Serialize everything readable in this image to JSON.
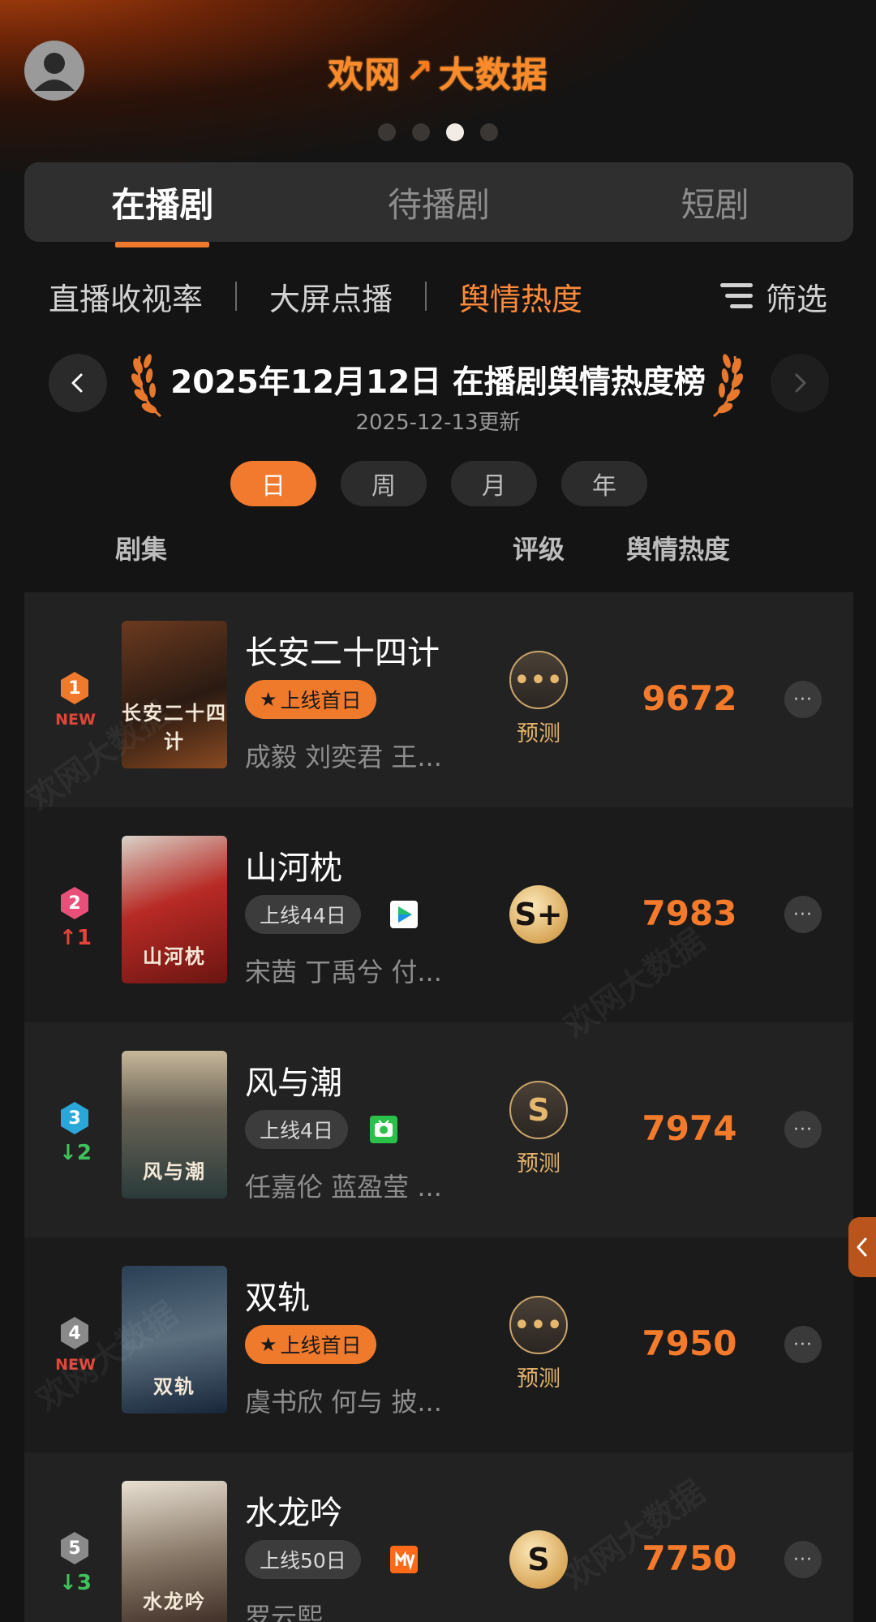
{
  "header": {
    "logo_text": "欢网",
    "logo_mark": "↗",
    "logo_text2": "大数据",
    "carousel_dots": 4,
    "carousel_active": 3
  },
  "main_tabs": [
    "在播剧",
    "待播剧",
    "短剧"
  ],
  "sub_tabs": [
    "直播收视率",
    "大屏点播",
    "舆情热度"
  ],
  "filter_label": "筛选",
  "chart_title": "2025年12月12日 在播剧舆情热度榜",
  "update_time": "2025-12-13更新",
  "periods": [
    "日",
    "周",
    "月",
    "年"
  ],
  "columns": {
    "show": "剧集",
    "rating": "评级",
    "heat": "舆情热度"
  },
  "rows": [
    {
      "rank": "1",
      "rank_color": "#f07a2c",
      "change": "NEW",
      "change_type": "new",
      "title": "长安二十四计",
      "poster_text": "长安二十四计",
      "tag": "上线首日",
      "tag_type": "hot",
      "platform": "",
      "cast": "成毅 刘奕君 王...",
      "rating": "•••",
      "rating_type": "pending",
      "rating_label": "预测",
      "heat": "9672"
    },
    {
      "rank": "2",
      "rank_color": "#e8507a",
      "change": "↑1",
      "change_type": "up",
      "title": "山河枕",
      "poster_text": "山河枕",
      "tag": "上线44日",
      "tag_type": "days",
      "platform": "iqiyi-icon",
      "cast": "宋茜 丁禹兮 付...",
      "rating": "S+",
      "rating_type": "splus",
      "rating_label": "",
      "heat": "7983"
    },
    {
      "rank": "3",
      "rank_color": "#2aa7d9",
      "change": "↓2",
      "change_type": "down",
      "title": "风与潮",
      "poster_text": "风与潮",
      "tag": "上线4日",
      "tag_type": "days",
      "platform": "youku-icon",
      "cast": "任嘉伦 蓝盈莹 ...",
      "rating": "S",
      "rating_type": "s-dark",
      "rating_label": "预测",
      "heat": "7974"
    },
    {
      "rank": "4",
      "rank_color": "#8a8a8a",
      "change": "NEW",
      "change_type": "new",
      "title": "双轨",
      "poster_text": "双轨",
      "tag": "上线首日",
      "tag_type": "hot",
      "platform": "",
      "cast": "虞书欣 何与 披...",
      "rating": "•••",
      "rating_type": "pending",
      "rating_label": "预测",
      "heat": "7950"
    },
    {
      "rank": "5",
      "rank_color": "#8a8a8a",
      "change": "↓3",
      "change_type": "down",
      "title": "水龙吟",
      "poster_text": "水龙吟",
      "tag": "上线50日",
      "tag_type": "days",
      "platform": "mgtv-icon",
      "cast": "罗云熙 ...",
      "rating": "S",
      "rating_type": "s-gold",
      "rating_label": "",
      "heat": "7750"
    }
  ],
  "watermark": "欢网大数据"
}
